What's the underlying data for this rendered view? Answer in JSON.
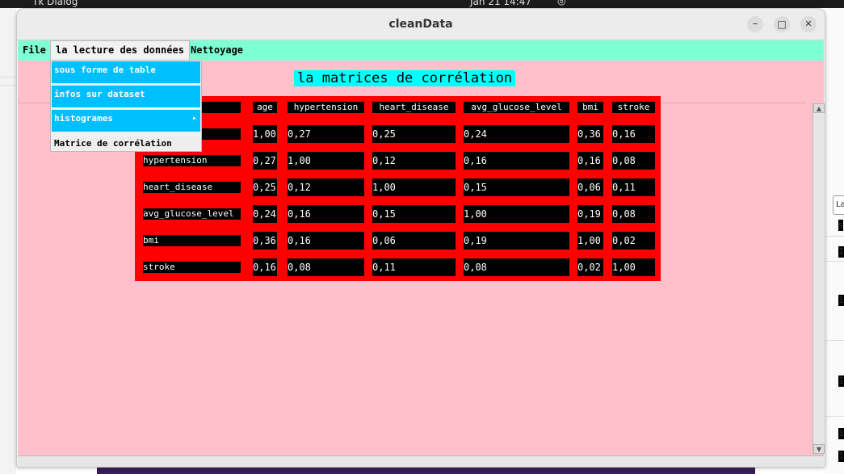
{
  "desktop": {
    "left_text": "Tk Dialog",
    "center_text": "Jan 21  14:47",
    "right_cells": [
      "La",
      "s",
      "1",
      "1",
      "1",
      "1",
      "1"
    ]
  },
  "window": {
    "title": "cleanData",
    "buttons": {
      "minimize": "–",
      "maximize": "□",
      "close": "✕"
    }
  },
  "menubar": {
    "items": [
      "File",
      "la lecture des données",
      "Nettoyage"
    ],
    "active_index": 1
  },
  "dropdown": {
    "items": [
      {
        "label": "sous forme de table",
        "submenu": false
      },
      {
        "label": "infos sur dataset",
        "submenu": false
      },
      {
        "label": "histogrames",
        "submenu": true
      },
      {
        "label": "Matrice de corrélation",
        "submenu": false,
        "selected": true
      }
    ],
    "submenu_arrow": "▸"
  },
  "content": {
    "heading": "la matrices de corrélation"
  },
  "matrix": {
    "columns": [
      "age",
      "hypertension",
      "heart_disease",
      "avg_glucose_level",
      "bmi",
      "stroke"
    ],
    "rows": [
      {
        "label": "",
        "values": [
          "1,00",
          "0,27",
          "0,25",
          "0,24",
          "0,36",
          "0,16"
        ]
      },
      {
        "label": "hypertension",
        "values": [
          "0,27",
          "1,00",
          "0,12",
          "0,16",
          "0,16",
          "0,08"
        ]
      },
      {
        "label": "heart_disease",
        "values": [
          "0,25",
          "0,12",
          "1,00",
          "0,15",
          "0,06",
          "0,11"
        ]
      },
      {
        "label": "avg_glucose_level",
        "values": [
          "0,24",
          "0,16",
          "0,15",
          "1,00",
          "0,19",
          "0,08"
        ]
      },
      {
        "label": "bmi",
        "values": [
          "0,36",
          "0,16",
          "0,06",
          "0,19",
          "1,00",
          "0,02"
        ]
      },
      {
        "label": "stroke",
        "values": [
          "0,16",
          "0,08",
          "0,11",
          "0,08",
          "0,02",
          "1,00"
        ]
      }
    ]
  },
  "scrollbar": {
    "up_arrow": "▲",
    "down_arrow": "▼"
  },
  "colors": {
    "menubar": "#7fffd4",
    "content_bg": "#ffc0cb",
    "matrix_bg": "#ff0000",
    "cell_bg": "#000000",
    "heading_bg": "#00ffff",
    "dropdown_item": "#00bfff"
  }
}
